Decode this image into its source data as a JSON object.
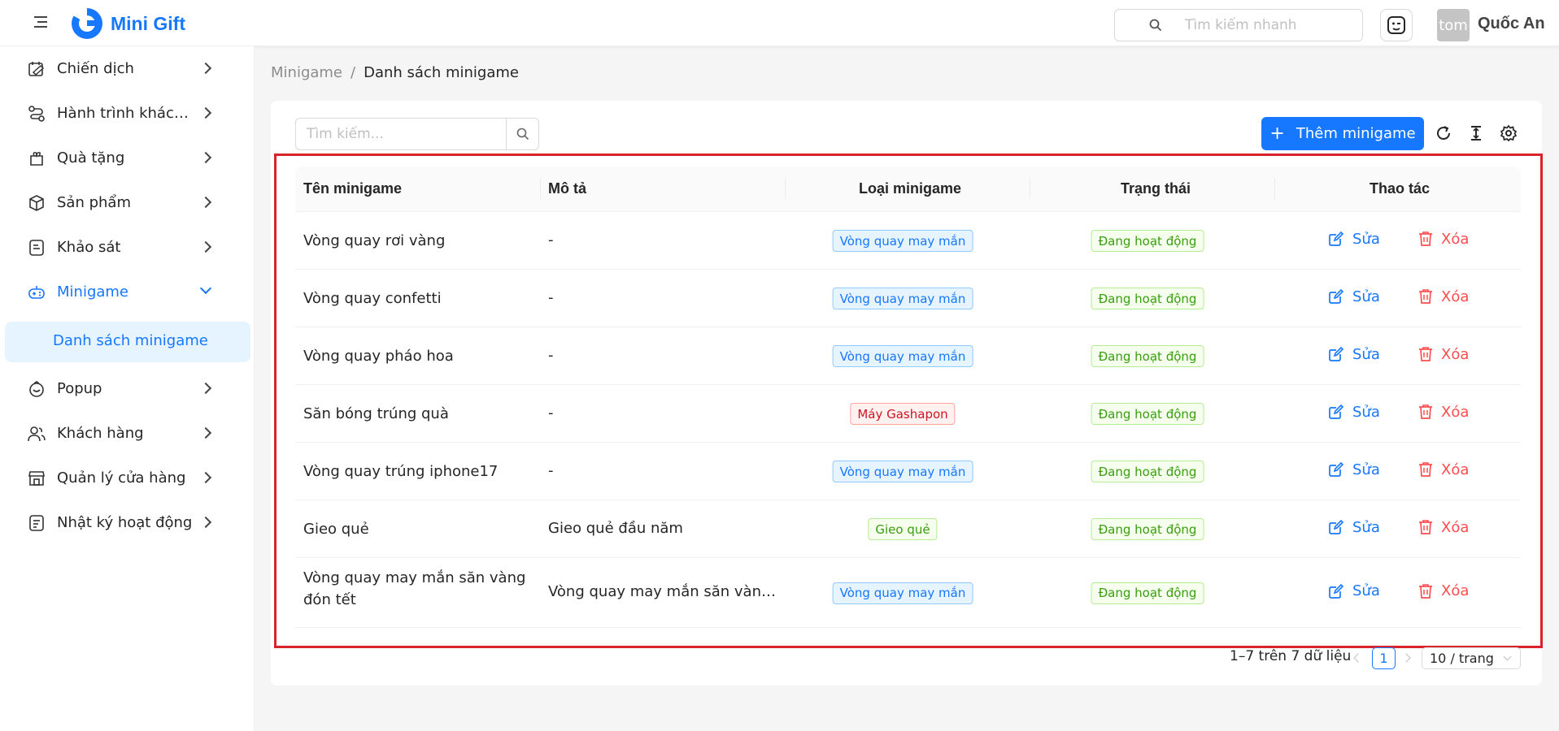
{
  "app": {
    "name": "Mini Gift",
    "brand_color": "#1677ff"
  },
  "header": {
    "search_placeholder": "Tìm kiếm nhanh",
    "user_avatar_text": "tom",
    "user_name": "Quốc An"
  },
  "sidebar": {
    "items": [
      {
        "label": "Chiến dịch",
        "icon": "campaign-icon"
      },
      {
        "label": "Hành trình khách hàng",
        "icon": "journey-icon"
      },
      {
        "label": "Quà tặng",
        "icon": "gift-icon"
      },
      {
        "label": "Sản phẩm",
        "icon": "product-icon"
      },
      {
        "label": "Khảo sát",
        "icon": "survey-icon"
      },
      {
        "label": "Minigame",
        "icon": "game-icon"
      },
      {
        "label": "Popup",
        "icon": "popup-icon"
      },
      {
        "label": "Khách hàng",
        "icon": "customers-icon"
      },
      {
        "label": "Quản lý cửa hàng",
        "icon": "store-icon"
      },
      {
        "label": "Nhật ký hoạt động",
        "icon": "log-icon"
      }
    ],
    "active_sub_item": "Danh sách minigame"
  },
  "breadcrumb": {
    "parent": "Minigame",
    "separator": "/",
    "current": "Danh sách minigame"
  },
  "toolbar": {
    "search_placeholder": "Tìm kiếm...",
    "add_button_label": "Thêm minigame"
  },
  "table": {
    "headers": {
      "name": "Tên minigame",
      "description": "Mô tả",
      "type": "Loại minigame",
      "status": "Trạng thái",
      "actions": "Thao tác"
    },
    "rows": [
      {
        "name": "Vòng quay rơi vàng",
        "description": "-",
        "type": "Vòng quay may mắn",
        "type_color": "blue",
        "status": "Đang hoạt động"
      },
      {
        "name": "Vòng quay confetti",
        "description": "-",
        "type": "Vòng quay may mắn",
        "type_color": "blue",
        "status": "Đang hoạt động"
      },
      {
        "name": "Vòng quay pháo hoa",
        "description": "-",
        "type": "Vòng quay may mắn",
        "type_color": "blue",
        "status": "Đang hoạt động"
      },
      {
        "name": "Săn bóng trúng quà",
        "description": "-",
        "type": "Máy Gashapon",
        "type_color": "red",
        "status": "Đang hoạt động"
      },
      {
        "name": "Vòng quay trúng iphone17",
        "description": "-",
        "type": "Vòng quay may mắn",
        "type_color": "blue",
        "status": "Đang hoạt động"
      },
      {
        "name": "Gieo quẻ",
        "description": "Gieo quẻ đầu năm",
        "type": "Gieo quẻ",
        "type_color": "green",
        "status": "Đang hoạt động"
      },
      {
        "name": "Vòng quay may mắn săn vàng đón tết",
        "description": "Vòng quay may mắn săn vàng đó...",
        "type": "Vòng quay may mắn",
        "type_color": "blue",
        "status": "Đang hoạt động"
      }
    ],
    "edit_label": "Sửa",
    "delete_label": "Xóa"
  },
  "pagination": {
    "total_text": "1–7 trên 7 dữ liệu",
    "current_page": "1",
    "page_size": "10 / trang"
  }
}
